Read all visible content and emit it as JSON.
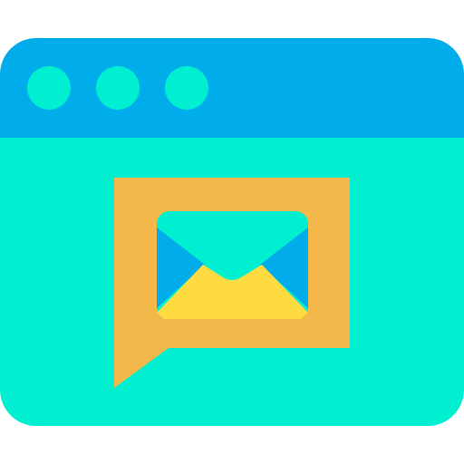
{
  "icon": {
    "name": "browser-window-email-message-icon",
    "colors": {
      "title_bar": "#00ACEA",
      "window_body": "#00EFD1",
      "window_dots": "#00EFD1",
      "speech_bubble": "#F4B74A",
      "envelope_top": "#00EFD1",
      "envelope_sides": "#00ACEA",
      "envelope_bottom": "#FEDB41"
    },
    "window_dot_count": 3
  }
}
